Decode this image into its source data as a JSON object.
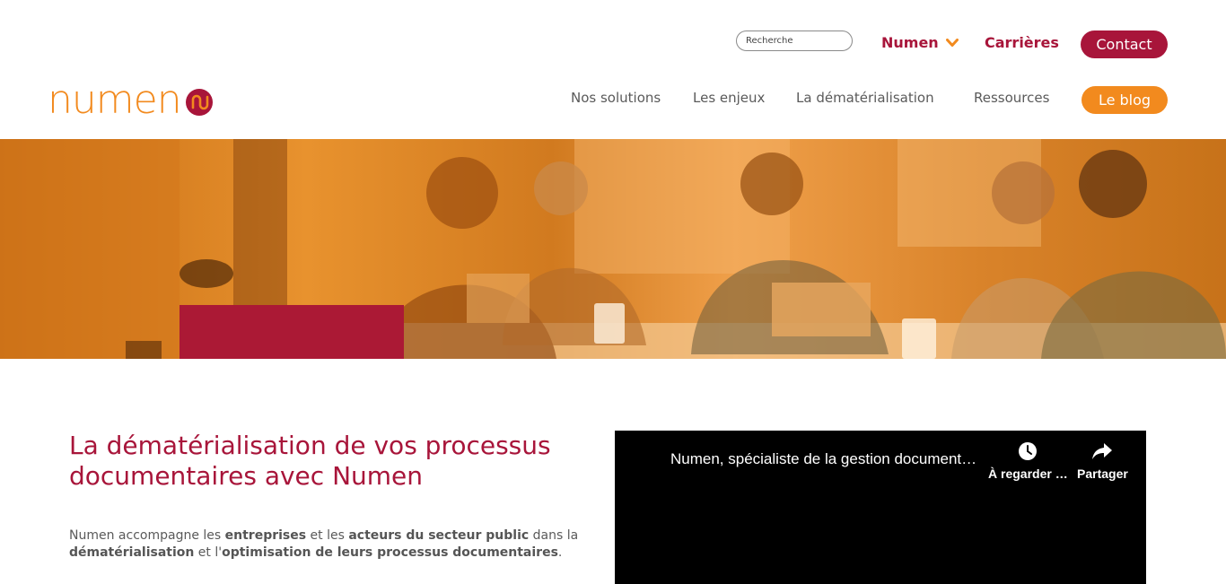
{
  "header": {
    "search_placeholder": "Recherche",
    "top_links": [
      {
        "label": "Numen"
      },
      {
        "label": "Carrières"
      }
    ],
    "contact_label": "Contact",
    "blog_label": "Le blog",
    "nav": [
      {
        "label": "Nos solutions"
      },
      {
        "label": "Les enjeux"
      },
      {
        "label": "La dématérialisation"
      },
      {
        "label": "Ressources"
      }
    ],
    "logo_text": "numen"
  },
  "colors": {
    "brand_red": "#a8153a",
    "brand_orange": "#f28a1e"
  },
  "main": {
    "headline": "La dématérialisation de vos processus documentaires avec Numen",
    "intro": {
      "t1": "Numen accompagne les ",
      "b1": "entreprises",
      "t2": " et les ",
      "b2": "acteurs du secteur public",
      "t3": " dans la ",
      "b3": "dématérialisation",
      "t4": " et l'",
      "b4": "optimisation de leurs processus documentaires",
      "t5": "."
    }
  },
  "video": {
    "title": "Numen, spécialiste de la gestion documentaire",
    "watch_later_label": "À regarder …",
    "share_label": "Partager"
  }
}
